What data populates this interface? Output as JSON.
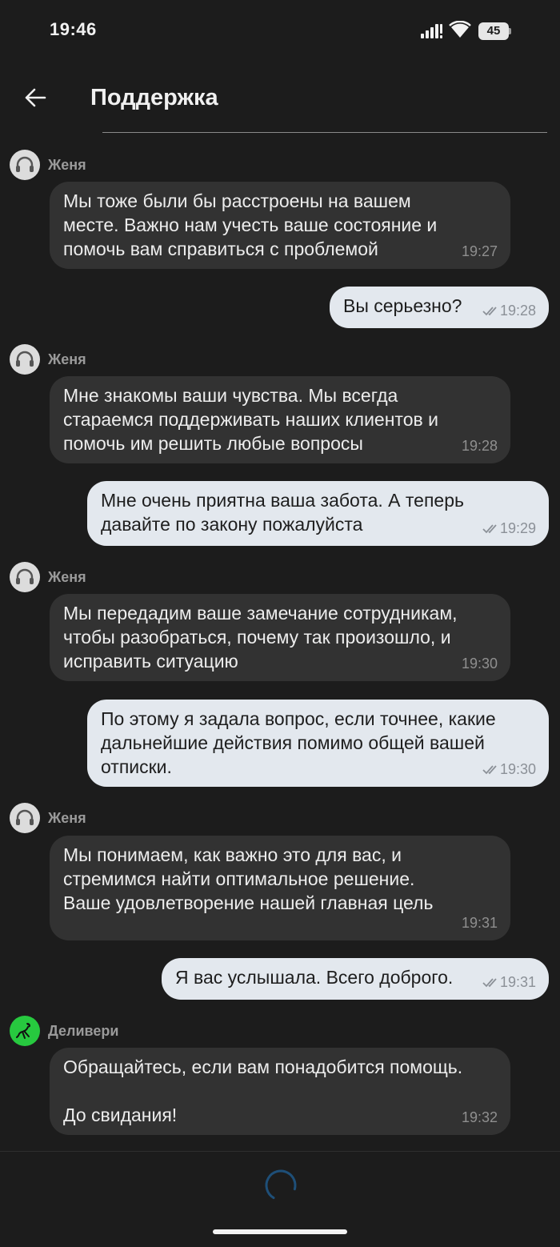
{
  "status_bar": {
    "time": "19:46",
    "battery": "45"
  },
  "header": {
    "title": "Поддержка"
  },
  "messages": [
    {
      "sender": "Женя",
      "text": "Мы тоже были бы расстроены на вашем\nместе. Важно нам учесть ваше состояние и\nпомочь вам справиться с проблемой",
      "time": "19:27"
    },
    {
      "text": "Вы серьезно?",
      "time": "19:28"
    },
    {
      "sender": "Женя",
      "text": "Мне знакомы ваши чувства. Мы всегда\nстараемся поддерживать наших клиентов и\nпомочь им решить любые вопросы",
      "time": "19:28"
    },
    {
      "text": "Мне очень приятна ваша забота. А теперь\nдавайте по закону пожалуйста",
      "time": "19:29"
    },
    {
      "sender": "Женя",
      "text": "Мы передадим ваше замечание сотрудникам,\nчтобы разобраться, почему так произошло, и\nисправить ситуацию",
      "time": "19:30"
    },
    {
      "text": "По этому я задала вопрос, если точнее, какие\nдальнейшие действия помимо общей вашей\nотписки.",
      "time": "19:30"
    },
    {
      "sender": "Женя",
      "text": "Мы понимаем, как важно это для вас, и\nстремимся найти оптимальное решение.\nВаше удовлетворение нашей главная цель",
      "time": "19:31"
    },
    {
      "text": "Я вас услышала. Всего доброго.",
      "time": "19:31"
    },
    {
      "sender": "Деливери",
      "text": "Обращайтесь, если вам понадобится помощь.\n\nДо свидания!",
      "time": "19:32"
    }
  ],
  "colors": {
    "background": "#1c1c1c",
    "incoming_bubble": "#323232",
    "outgoing_bubble": "#e3e8ee",
    "delivery_avatar": "#27c93f",
    "spinner": "#1e4f78"
  }
}
